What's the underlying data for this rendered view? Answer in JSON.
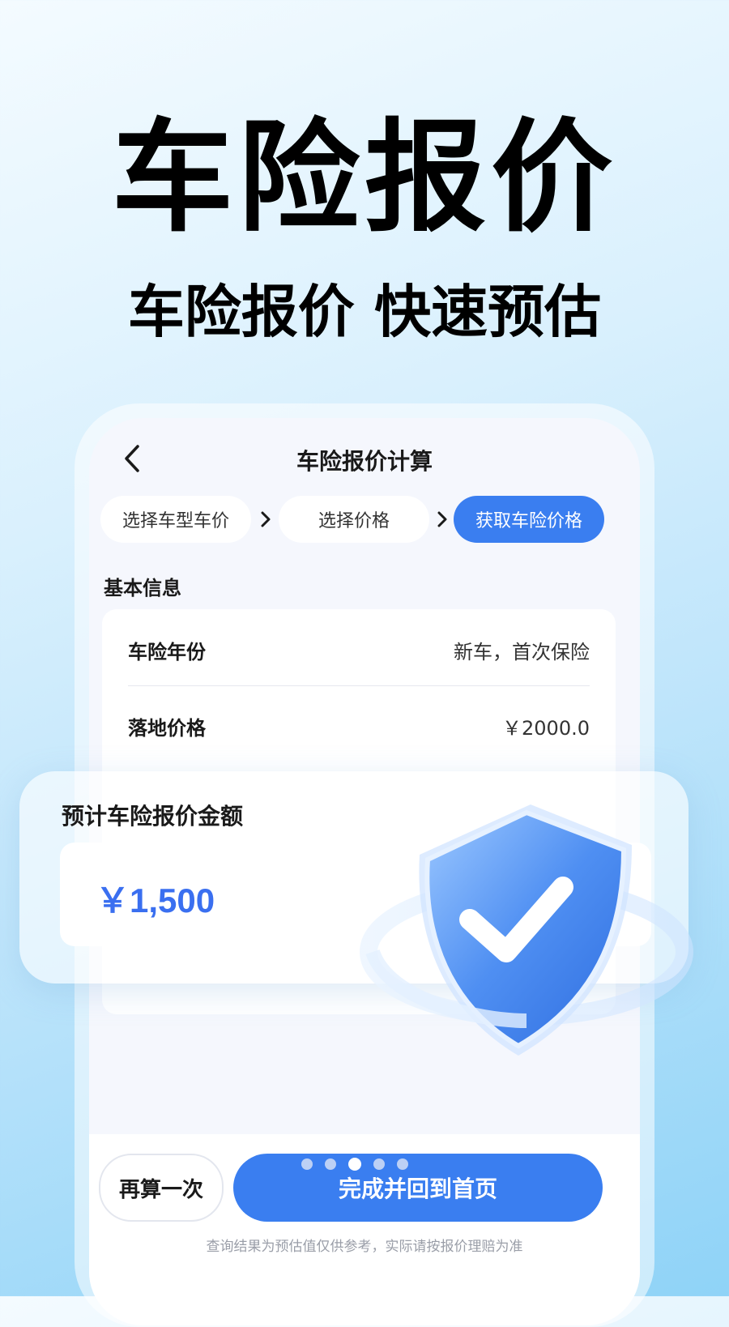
{
  "hero": {
    "title": "车险报价",
    "subtitle": "车险报价 快速预估"
  },
  "app": {
    "page_title": "车险报价计算",
    "steps": [
      {
        "label": "选择车型车价",
        "active": false
      },
      {
        "label": "选择价格",
        "active": false
      },
      {
        "label": "获取车险价格",
        "active": true
      }
    ],
    "section_label": "基本信息",
    "info_rows": [
      {
        "key": "车险年份",
        "value": "新车，首次保险"
      },
      {
        "key": "落地价格",
        "value": "￥2000.0"
      }
    ],
    "estimate": {
      "title": "预计车险报价金额",
      "amount": "￥1,500"
    },
    "buttons": {
      "retry": "再算一次",
      "finish": "完成并回到首页"
    },
    "disclaimer": "查询结果为预估值仅供参考，实际请按报价理赔为准"
  },
  "pager": {
    "count": 5,
    "active_index": 2
  },
  "colors": {
    "accent": "#3a7ef0",
    "amount": "#3a6ff0",
    "background_top": "#f4fbff",
    "background_bottom": "#8fd3f7"
  },
  "icons": [
    "back-arrow-icon",
    "chevron-right-icon",
    "shield-check-icon"
  ]
}
